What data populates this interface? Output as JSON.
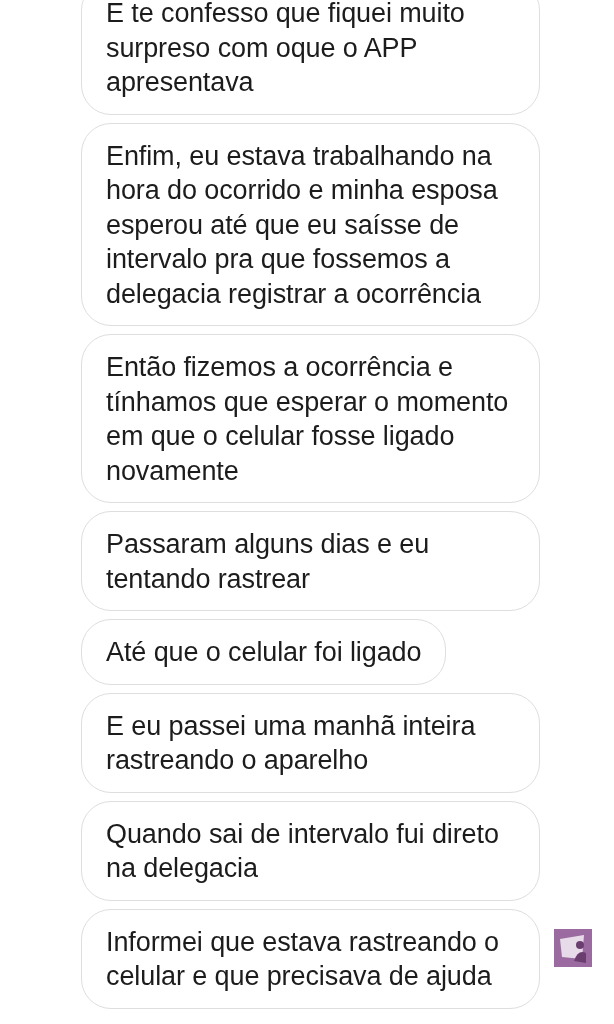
{
  "messages": [
    {
      "text": "E te confesso que fiquei muito surpreso com oque o APP apresentava",
      "avatar": false
    },
    {
      "text": "Enfim, eu estava trabalhando na hora do ocorrido e minha esposa esperou até que eu saísse de intervalo pra que fossemos a delegacia registrar a ocorrência",
      "avatar": false
    },
    {
      "text": "Então fizemos a ocorrência e tínhamos que esperar o momento em que o celular fosse ligado novamente",
      "avatar": false
    },
    {
      "text": "Passaram alguns dias e eu tentando rastrear",
      "avatar": false
    },
    {
      "text": "Até que o celular foi ligado",
      "avatar": false
    },
    {
      "text": "E eu passei uma manhã inteira rastreando o aparelho",
      "avatar": false
    },
    {
      "text": "Quando sai de intervalo fui direto na delegacia",
      "avatar": false
    },
    {
      "text": "Informei que estava rastreando o celular e que precisava de ajuda",
      "avatar": true
    }
  ]
}
